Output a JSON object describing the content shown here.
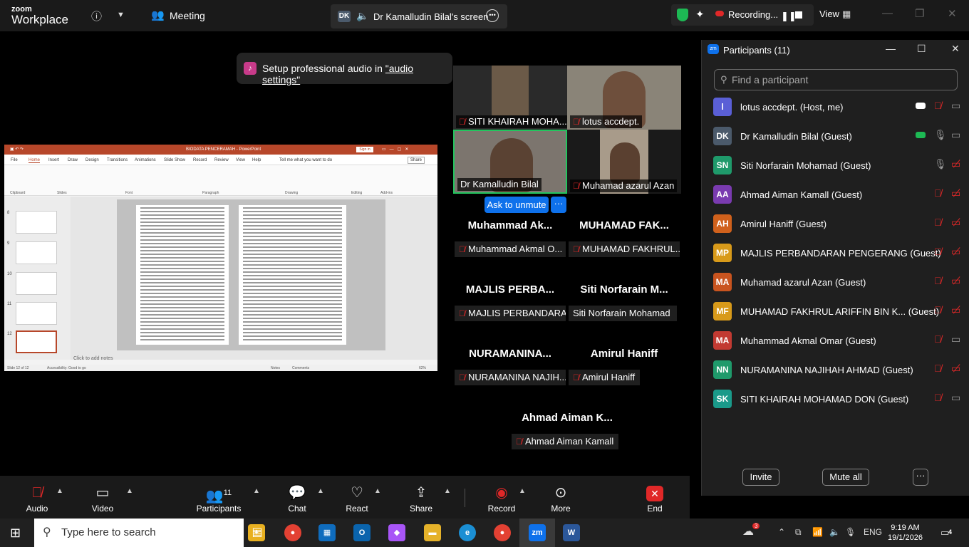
{
  "app": {
    "logo_line1": "zoom",
    "logo_line2": "Workplace",
    "meeting_label": "Meeting"
  },
  "top": {
    "screen_initials": "DK",
    "screen_title": "Dr Kamalludin Bilal's screen",
    "recording_label": "Recording...",
    "view_label": "View"
  },
  "toast": {
    "prefix": "Setup professional audio in ",
    "link": "\"audio settings\""
  },
  "ppt": {
    "title": "BIODATA PENCERAMAH - PowerPoint",
    "signin": "Sign in",
    "tabs": [
      "File",
      "Home",
      "Insert",
      "Draw",
      "Design",
      "Transitions",
      "Animations",
      "Slide Show",
      "Record",
      "Review",
      "View",
      "Help",
      "Tell me what you want to do"
    ],
    "share": "Share",
    "groups": [
      "Clipboard",
      "Slides",
      "Font",
      "Paragraph",
      "Drawing",
      "Editing",
      "Add-ins"
    ],
    "thumb_numbers": [
      "8",
      "9",
      "10",
      "11",
      "12"
    ],
    "notes": "Click to add notes",
    "status_left": "Slide 12 of 12",
    "status_access": "Accessibility: Good to go",
    "status_notes": "Notes",
    "status_comments": "Comments",
    "zoom": "62%"
  },
  "gallery": {
    "videos": [
      {
        "name": "SITI KHAIRAH MOHA..."
      },
      {
        "name": "lotus accdept."
      },
      {
        "name": "Dr Kamalludin Bilal"
      },
      {
        "name": "Muhamad azarul Azan"
      }
    ],
    "unmute_label": "Ask to unmute",
    "unmute_more": "···",
    "tiles": [
      {
        "big": "Muhammad Ak...",
        "small": "Muhammad Akmal O..."
      },
      {
        "big": "MUHAMAD FAK...",
        "small": "MUHAMAD FAKHRUL..."
      },
      {
        "big": "MAJLIS PERBA...",
        "small": "MAJLIS PERBANDARA..."
      },
      {
        "big": "Siti Norfarain M...",
        "small": "Siti Norfarain Mohamad"
      },
      {
        "big": "NURAMANINA...",
        "small": "NURAMANINA NAJIH..."
      },
      {
        "big": "Amirul Haniff",
        "small": "Amirul Haniff"
      },
      {
        "big": "Ahmad Aiman K...",
        "small": "Ahmad Aiman Kamall"
      }
    ]
  },
  "panel": {
    "title": "Participants (11)",
    "search_placeholder": "Find a participant",
    "participants": [
      {
        "initials": "l",
        "name": "lotus accdept. (Host, me)",
        "color": "#5a5fd6"
      },
      {
        "initials": "DK",
        "name": "Dr Kamalludin Bilal (Guest)",
        "color": "#4b5a6b"
      },
      {
        "initials": "SN",
        "name": "Siti Norfarain Mohamad (Guest)",
        "color": "#1f9a6b"
      },
      {
        "initials": "AA",
        "name": "Ahmad Aiman Kamall (Guest)",
        "color": "#7a3bb0"
      },
      {
        "initials": "AH",
        "name": "Amirul Haniff (Guest)",
        "color": "#d0611c"
      },
      {
        "initials": "MP",
        "name": "MAJLIS PERBANDARAN PENGERANG (Guest)",
        "color": "#d89a1a"
      },
      {
        "initials": "MA",
        "name": "Muhamad azarul Azan (Guest)",
        "color": "#c9541f"
      },
      {
        "initials": "MF",
        "name": "MUHAMAD FAKHRUL ARIFFIN BIN K...  (Guest)",
        "color": "#d89a1a"
      },
      {
        "initials": "MA",
        "name": "Muhammad Akmal Omar (Guest)",
        "color": "#c23a32"
      },
      {
        "initials": "NN",
        "name": "NURAMANINA NAJIHAH AHMAD (Guest)",
        "color": "#1f9a6b"
      },
      {
        "initials": "SK",
        "name": "SITI KHAIRAH MOHAMAD DON (Guest)",
        "color": "#1a9a8a"
      }
    ],
    "invite": "Invite",
    "mute_all": "Mute all",
    "more": "···"
  },
  "toolbar": {
    "audio": "Audio",
    "video": "Video",
    "participants": "Participants",
    "participants_count": "11",
    "chat": "Chat",
    "react": "React",
    "share": "Share",
    "record": "Record",
    "more": "More",
    "end": "End"
  },
  "taskbar": {
    "search_placeholder": "Type here to search",
    "lang": "ENG",
    "time": "9:19 AM",
    "date": "19/1/2026",
    "notifications": "4",
    "badge": "3"
  }
}
